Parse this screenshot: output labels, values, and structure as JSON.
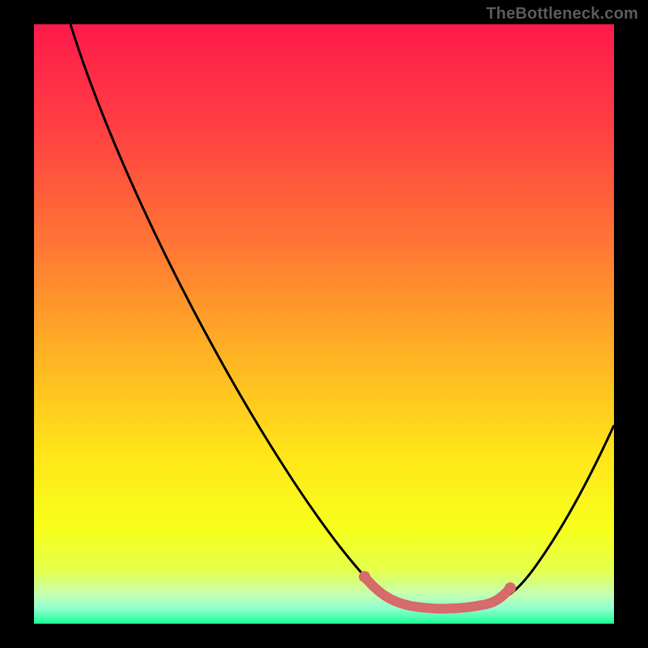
{
  "watermark": "TheBottleneck.com",
  "colors": {
    "gradient_top": "#ff1a4b",
    "gradient_bottom": "#19ff91",
    "curve": "#000000",
    "highlight": "#d76a6a",
    "frame": "#000000"
  },
  "chart_data": {
    "type": "line",
    "title": "",
    "xlabel": "",
    "ylabel": "",
    "x_range": [
      0,
      100
    ],
    "y_range": [
      0,
      100
    ],
    "grid": false,
    "legend": false,
    "series": [
      {
        "name": "bottleneck-curve",
        "x": [
          6,
          12,
          20,
          28,
          36,
          44,
          52,
          58,
          63,
          67,
          72,
          78,
          83,
          88,
          94,
          100
        ],
        "y": [
          100,
          85,
          70,
          56,
          44,
          32,
          20,
          12,
          6,
          3,
          2,
          3,
          8,
          18,
          28,
          34
        ]
      }
    ],
    "highlight_range": {
      "name": "optimal-zone",
      "x_start": 58,
      "x_end": 82,
      "y_approx": 2
    },
    "background_gradient": {
      "orientation": "vertical",
      "stops": [
        {
          "pos": 0.0,
          "color": "#ff1a4b"
        },
        {
          "pos": 0.18,
          "color": "#ff4142"
        },
        {
          "pos": 0.38,
          "color": "#ff7a33"
        },
        {
          "pos": 0.55,
          "color": "#ffb224"
        },
        {
          "pos": 0.72,
          "color": "#ffe619"
        },
        {
          "pos": 0.84,
          "color": "#f7ff1a"
        },
        {
          "pos": 0.91,
          "color": "#e5ff4a"
        },
        {
          "pos": 0.95,
          "color": "#c6ffb0"
        },
        {
          "pos": 0.975,
          "color": "#8fffd0"
        },
        {
          "pos": 1.0,
          "color": "#19ff91"
        }
      ]
    }
  }
}
